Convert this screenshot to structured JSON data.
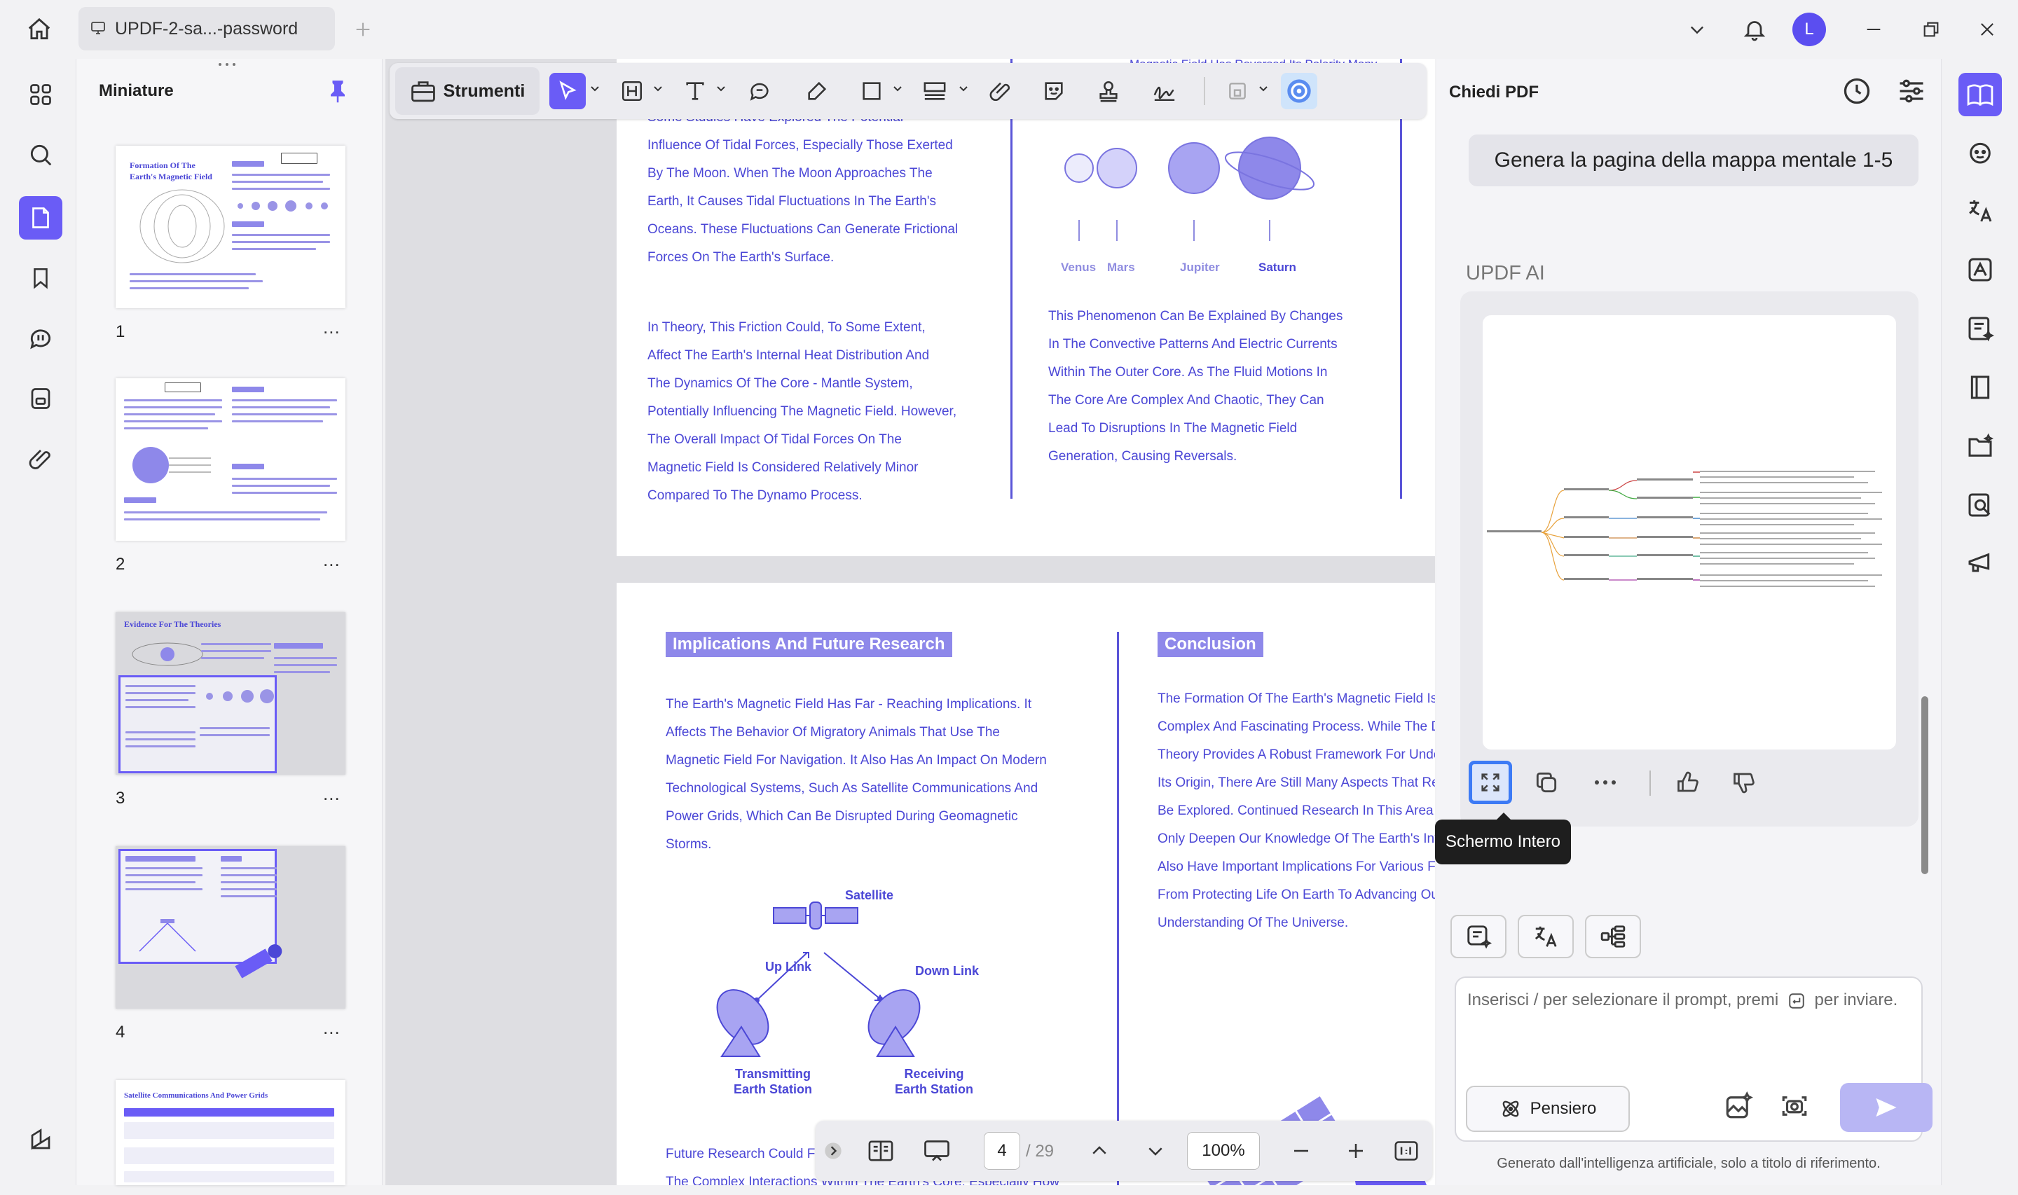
{
  "titlebar": {
    "tab_title": "UPDF-2-sa...-password",
    "user_initial": "L",
    "colors": {
      "accent": "#6a5cf6",
      "avatar": "#5b4ef0"
    }
  },
  "thumbnails": {
    "title": "Miniature",
    "pages": [
      {
        "num": "1",
        "heading": "Formation Of The Earth's Magnetic Field"
      },
      {
        "num": "2",
        "heading": ""
      },
      {
        "num": "3",
        "heading": "Evidence For The Theories"
      },
      {
        "num": "4",
        "heading": ""
      },
      {
        "num": "",
        "heading": "Satellite Communications And Power Grids"
      }
    ],
    "more": "..."
  },
  "toolbar": {
    "strumenti_label": "Strumenti",
    "icons": [
      "select-icon",
      "heading-icon",
      "text-icon",
      "comment-icon",
      "highlight-icon",
      "shape-icon",
      "stamp-ruler-icon",
      "attach-icon",
      "sticker-icon",
      "stamp-icon",
      "signature-icon",
      "save-icon",
      "ai-assistant-icon"
    ]
  },
  "document": {
    "page_top": {
      "top_cut_left": "Magnetic Field Has Reversed Its Polarity Many",
      "left_col": [
        "Some Studies Have Explored The Potential",
        "Influence Of Tidal Forces, Especially Those Exerted",
        "By The Moon. When The Moon Approaches The",
        "Earth, It Causes Tidal Fluctuations In The Earth's",
        "Oceans. These Fluctuations Can Generate Frictional",
        "Forces On The Earth's Surface."
      ],
      "left_col_2": [
        " In Theory, This Friction Could, To Some Extent,",
        "Affect The Earth's Internal Heat Distribution And",
        "The Dynamics Of The Core - Mantle System,",
        "Potentially Influencing The Magnetic Field. However,",
        "The Overall Impact Of Tidal Forces On The",
        "Magnetic Field Is Considered Relatively Minor",
        "Compared To The Dynamo Process."
      ],
      "planets": [
        "Venus",
        "Mars",
        "Jupiter",
        "Saturn"
      ],
      "right_col": [
        "This Phenomenon Can Be Explained By Changes",
        "In The Convective Patterns And Electric Currents",
        "Within The Outer Core. As The Fluid Motions In",
        "The Core Are Complex And Chaotic, They Can",
        "Lead To Disruptions In The Magnetic Field",
        "Generation, Causing Reversals."
      ]
    },
    "page_bottom": {
      "left_heading": "Implications And Future Research",
      "left_col": [
        "The Earth's Magnetic Field Has Far - Reaching Implications. It",
        "Affects The Behavior Of Migratory Animals That Use The",
        "Magnetic Field For Navigation. It Also Has An Impact On Modern",
        "Technological Systems, Such As Satellite Communications And",
        "Power Grids, Which Can Be Disrupted During Geomagnetic",
        "Storms."
      ],
      "diagram": {
        "satellite": "Satellite",
        "up_link": "Up Link",
        "down_link": "Down Link",
        "transmitting": [
          "Transmitting",
          "Earth Station"
        ],
        "receiving": [
          "Receiving",
          "Earth Station"
        ]
      },
      "left_footer": [
        "Future Research Could F",
        "The Complex Interactions Within The Earth's Core, Especially How"
      ],
      "right_heading": "Conclusion",
      "right_col": [
        "The Formation Of The Earth's Magnetic Field Is A",
        "Complex And Fascinating Process. While The Dy",
        "Theory Provides A Robust Framework For Under",
        "Its Origin, There Are Still Many Aspects That Rer",
        "Be Explored. Continued Research In This Area W",
        "Only Deepen Our Knowledge Of The Earth's Inte",
        "Also Have Important Implications For Various Fie",
        "From Protecting Life On Earth To Advancing Our",
        "Understanding Of The Universe."
      ]
    }
  },
  "bottom_nav": {
    "current_page": "4",
    "total_pages": "/ 29",
    "zoom": "100%"
  },
  "ai_panel": {
    "title": "Chiedi PDF",
    "user_message": "Genera la pagina della mappa mentale 1-5",
    "ai_label": "UPDF AI",
    "tooltip": "Schermo Intero",
    "input_placeholder": "Inserisci / per selezionare il prompt, premi",
    "input_placeholder_end": "per inviare.",
    "pensiero_label": "Pensiero",
    "disclaimer": "Generato dall'intelligenza artificiale, solo a titolo di riferimento."
  }
}
